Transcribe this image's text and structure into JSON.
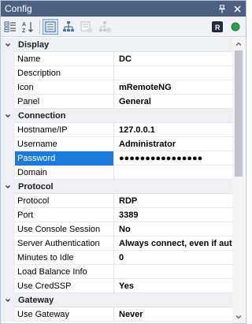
{
  "window": {
    "title": "Config"
  },
  "titlebar": {
    "pin_glyph": "ᴜ",
    "close_glyph": "×"
  },
  "toolbar": {
    "badge_letter": "R"
  },
  "categories": [
    {
      "label": "Display",
      "rows": [
        {
          "name": "Name",
          "value": "DC"
        },
        {
          "name": "Description",
          "value": ""
        },
        {
          "name": "Icon",
          "value": "mRemoteNG"
        },
        {
          "name": "Panel",
          "value": "General"
        }
      ]
    },
    {
      "label": "Connection",
      "rows": [
        {
          "name": "Hostname/IP",
          "value": "127.0.0.1"
        },
        {
          "name": "Username",
          "value": "Administrator"
        },
        {
          "name": "Password",
          "value": "●●●●●●●●●●●●●●●●",
          "selected": true
        },
        {
          "name": "Domain",
          "value": ""
        }
      ]
    },
    {
      "label": "Protocol",
      "rows": [
        {
          "name": "Protocol",
          "value": "RDP"
        },
        {
          "name": "Port",
          "value": "3389"
        },
        {
          "name": "Use Console Session",
          "value": "No"
        },
        {
          "name": "Server Authentication",
          "value": "Always connect, even if auth"
        },
        {
          "name": "Minutes to Idle",
          "value": "0"
        },
        {
          "name": "Load Balance Info",
          "value": ""
        },
        {
          "name": "Use CredSSP",
          "value": "Yes"
        }
      ]
    },
    {
      "label": "Gateway",
      "rows": [
        {
          "name": "Use Gateway",
          "value": "Never"
        }
      ]
    }
  ],
  "colors": {
    "titlebar": "#4d6082",
    "selection": "#1c7adb",
    "status_dot": "#2ea043"
  }
}
